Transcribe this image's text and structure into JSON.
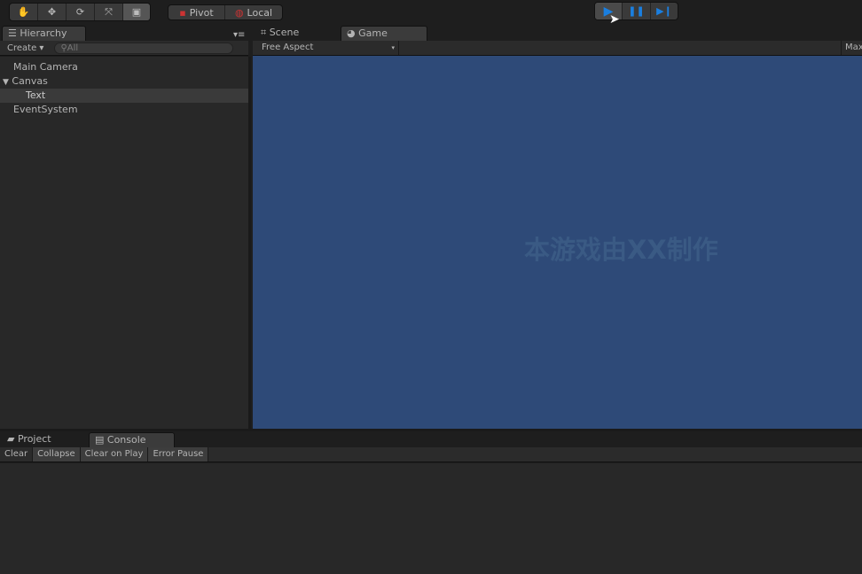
{
  "toolbar": {
    "tools": [
      "hand-tool",
      "move-tool",
      "rotate-tool",
      "scale-tool",
      "rect-tool"
    ],
    "pivot": "Pivot",
    "local": "Local",
    "play": "play",
    "pause": "pause",
    "step": "step"
  },
  "hierarchy": {
    "tab": "Hierarchy",
    "create": "Create",
    "search_placeholder": "All",
    "items": [
      {
        "label": "Main Camera"
      },
      {
        "label": "Canvas"
      },
      {
        "label": "Text"
      },
      {
        "label": "EventSystem"
      }
    ]
  },
  "scene_tab": "Scene",
  "game_tab": "Game",
  "game": {
    "aspect": "Free Aspect",
    "maximize": "Max",
    "overlay_text": "本游戏由XX制作",
    "bg": "#2e4a78"
  },
  "bottom": {
    "project_tab": "Project",
    "console_tab": "Console",
    "buttons": [
      "Clear",
      "Collapse",
      "Clear on Play",
      "Error Pause"
    ]
  }
}
